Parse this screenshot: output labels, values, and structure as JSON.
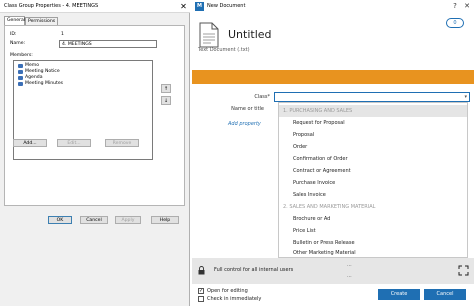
{
  "dialog": {
    "title": "Class Group Properties - 4. MEETINGS",
    "close": "✕",
    "tabs": [
      "General",
      "Permissions"
    ],
    "id_label": "ID:",
    "id_value": "1",
    "name_label": "Name:",
    "name_value": "4. MEETINGS",
    "members_label": "Members:",
    "members": [
      "Memo",
      "Meeting Notice",
      "Agenda",
      "Meeting Minutes"
    ],
    "buttons": {
      "add": "Add...",
      "edit": "Edit...",
      "remove": "Remove",
      "ok": "OK",
      "cancel": "Cancel",
      "apply": "Apply",
      "help": "Help"
    },
    "up_arrow": "↑",
    "down_arrow": "↓"
  },
  "new_document": {
    "window_title": "New Document",
    "logo": "M",
    "doc_title": "Untitled",
    "doc_subtitle": "Text Document (.txt)",
    "badge": "0",
    "class_label": "Class*",
    "name_label": "Name or title",
    "add_property": "Add property",
    "dropdown": [
      {
        "text": "1. PURCHASING AND SALES",
        "group": true
      },
      {
        "text": "Request for Proposal",
        "group": false
      },
      {
        "text": "Proposal",
        "group": false
      },
      {
        "text": "Order",
        "group": false
      },
      {
        "text": "Confirmation of Order",
        "group": false
      },
      {
        "text": "Contract or Agreement",
        "group": false
      },
      {
        "text": "Purchase Invoice",
        "group": false
      },
      {
        "text": "Sales Invoice",
        "group": false
      },
      {
        "text": "2. SALES AND MARKETING MATERIAL",
        "group": true
      },
      {
        "text": "Brochure or Ad",
        "group": false
      },
      {
        "text": "Price List",
        "group": false
      },
      {
        "text": "Bulletin or Press Release",
        "group": false
      },
      {
        "text": "Other Marketing Material",
        "group": false
      }
    ],
    "permission_text": "Full control for all internal users",
    "ellipsis": "...",
    "open_for_editing": "Open for editing",
    "check_in_immediately": "Check in immediately",
    "create": "Create",
    "cancel": "Cancel",
    "colors": {
      "accent": "#1f6fb3",
      "orange": "#e8931f"
    }
  }
}
